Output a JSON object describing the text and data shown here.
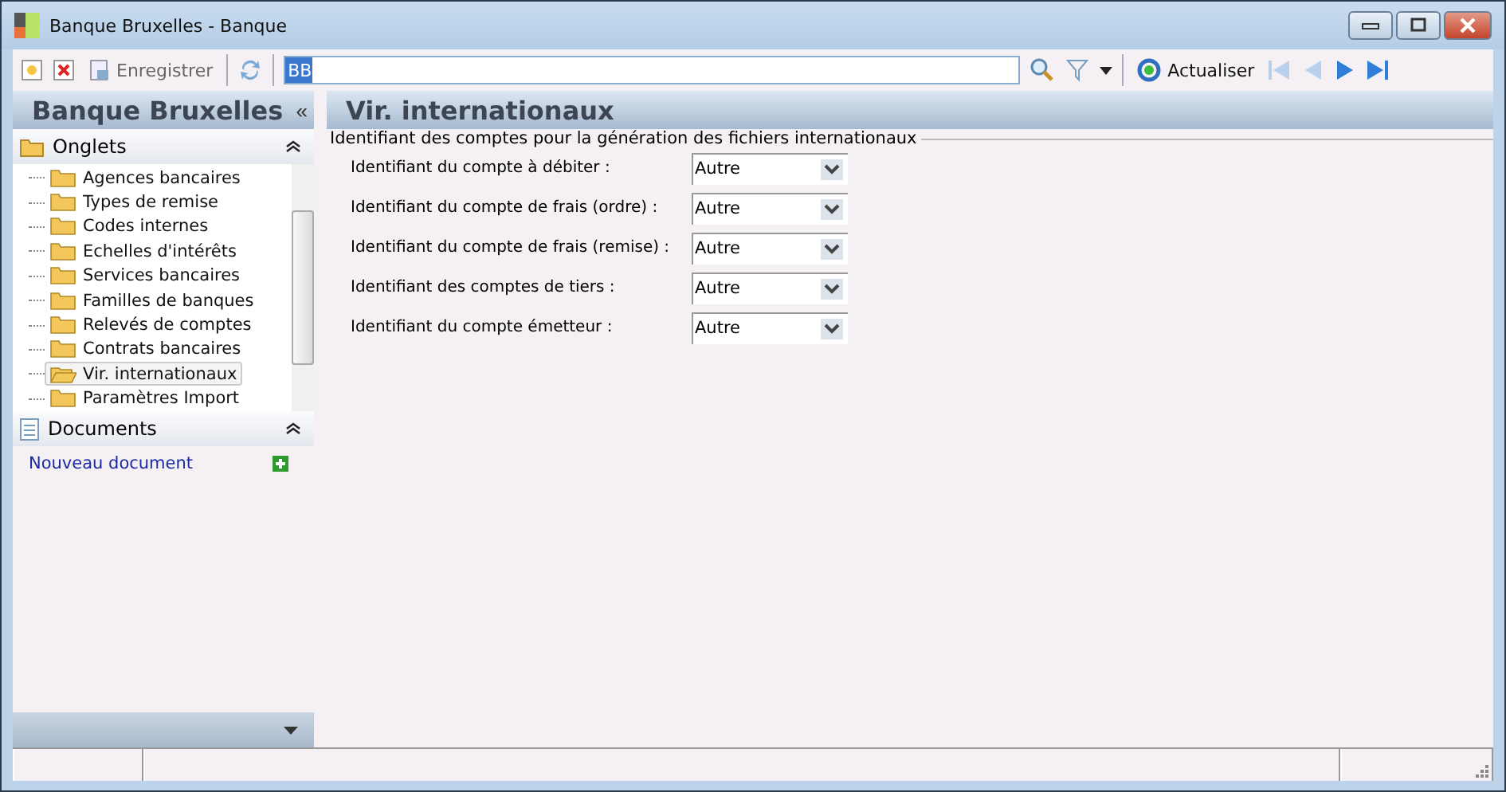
{
  "window": {
    "title": "Banque Bruxelles -  Banque"
  },
  "toolbar": {
    "save_label": "Enregistrer",
    "search_value": "BB",
    "refresh_label": "Actualiser"
  },
  "sidebar": {
    "title": "Banque Bruxelles",
    "collapse_glyph": "«",
    "sections": [
      {
        "title": "Onglets",
        "expanded": true,
        "items": [
          {
            "label": "Agences bancaires",
            "selected": false
          },
          {
            "label": "Types de remise",
            "selected": false
          },
          {
            "label": "Codes internes",
            "selected": false
          },
          {
            "label": "Echelles d'intérêts",
            "selected": false
          },
          {
            "label": "Services bancaires",
            "selected": false
          },
          {
            "label": "Familles de banques",
            "selected": false
          },
          {
            "label": "Relevés de comptes",
            "selected": false
          },
          {
            "label": "Contrats bancaires",
            "selected": false
          },
          {
            "label": "Vir. internationaux",
            "selected": true
          },
          {
            "label": "Paramètres Import",
            "selected": false
          }
        ]
      },
      {
        "title": "Documents",
        "expanded": true,
        "link": "Nouveau document"
      }
    ]
  },
  "content": {
    "title": "Vir. internationaux",
    "group_title": "Identifiant des comptes pour la génération des fichiers internationaux",
    "fields": [
      {
        "label": "Identifiant du compte à débiter :",
        "value": "Autre"
      },
      {
        "label": "Identifiant du compte de frais (ordre) :",
        "value": "Autre"
      },
      {
        "label": "Identifiant du compte de frais (remise) :",
        "value": "Autre"
      },
      {
        "label": "Identifiant des comptes de tiers :",
        "value": "Autre"
      },
      {
        "label": "Identifiant du compte émetteur :",
        "value": "Autre"
      }
    ]
  }
}
